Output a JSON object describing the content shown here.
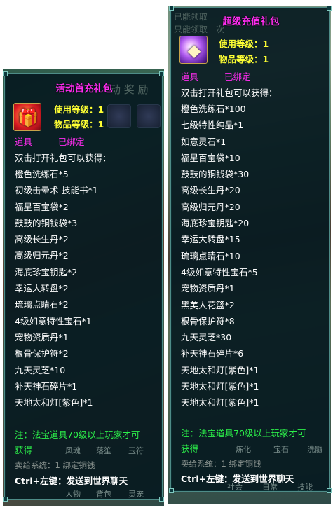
{
  "left_tooltip": {
    "title": "活动首充礼包",
    "bg_text": "动 奖 励",
    "icon": "red-gift-box-icon",
    "use_level": "使用等级：1",
    "item_level": "物品等级：1",
    "type": "道具",
    "binding": "已绑定",
    "intro": "双击打开礼包可以获得：",
    "contents": [
      "橙色洗练石*5",
      "初级击晕术-技能书*1",
      "福星百宝袋*2",
      "鼓鼓的铜钱袋*3",
      "高级长生丹*2",
      "高级归元丹*2",
      "海底珍宝钥匙*2",
      "幸运大转盘*2",
      "琉璃点睛石*2",
      "4级如意特性宝石*1",
      "宠物资质丹*1",
      "根骨保护符*2",
      "九天灵芝*10",
      "补天神石碎片*1",
      "天地太和灯[紫色]*1"
    ],
    "note_line1": "注：法宝道具70级以上玩家才可",
    "note_line2": "获得",
    "sell_info": "卖给系统：1 绑定铜钱",
    "shortcut": "Ctrl+左键：发送到世界聊天",
    "bottom_labels": [
      "风魂",
      "落笙",
      "玉符",
      "人物",
      "背包",
      "灵宠"
    ]
  },
  "right_tooltip": {
    "title": "超级充值礼包",
    "ghost_text_1": "已能领取",
    "ghost_text_2": "只能领取一次",
    "icon": "purple-crystal-box-icon",
    "use_level": "使用等级：1",
    "item_level": "物品等级：1",
    "type": "道具",
    "binding": "已绑定",
    "intro": "双击打开礼包可以获得：",
    "contents": [
      "橙色洗练石*100",
      "七级特性纯晶*1",
      "如意灵石*1",
      "福星百宝袋*10",
      "鼓鼓的铜钱袋*30",
      "高级长生丹*20",
      "高级归元丹*20",
      "海底珍宝钥匙*20",
      "幸运大转盘*15",
      "琉璃点睛石*10",
      "4级如意特性宝石*5",
      "宠物资质丹*1",
      "黑美人花篮*2",
      "根骨保护符*8",
      "九天灵芝*30",
      "补天神石碎片*6",
      "天地太和灯[紫色]*1",
      "天地太和灯[紫色]*1",
      "天地太和灯[紫色]*1"
    ],
    "note": "注：法宝道具70级以上玩家才可",
    "note_line2": "获得",
    "sell_info": "卖给系统：1 绑定铜钱",
    "shortcut": "Ctrl+左键：发送到世界聊天",
    "bottom_labels": [
      "炼化",
      "宝石",
      "洗髓",
      "社会",
      "日常",
      "技能"
    ]
  },
  "colors": {
    "title": "#ff2cf0",
    "level": "#ffff33",
    "body": "#ffffff",
    "note": "#2cf04a",
    "sell": "#8a938f",
    "border": "#4e8c88",
    "panel_bg": "#061a20"
  }
}
